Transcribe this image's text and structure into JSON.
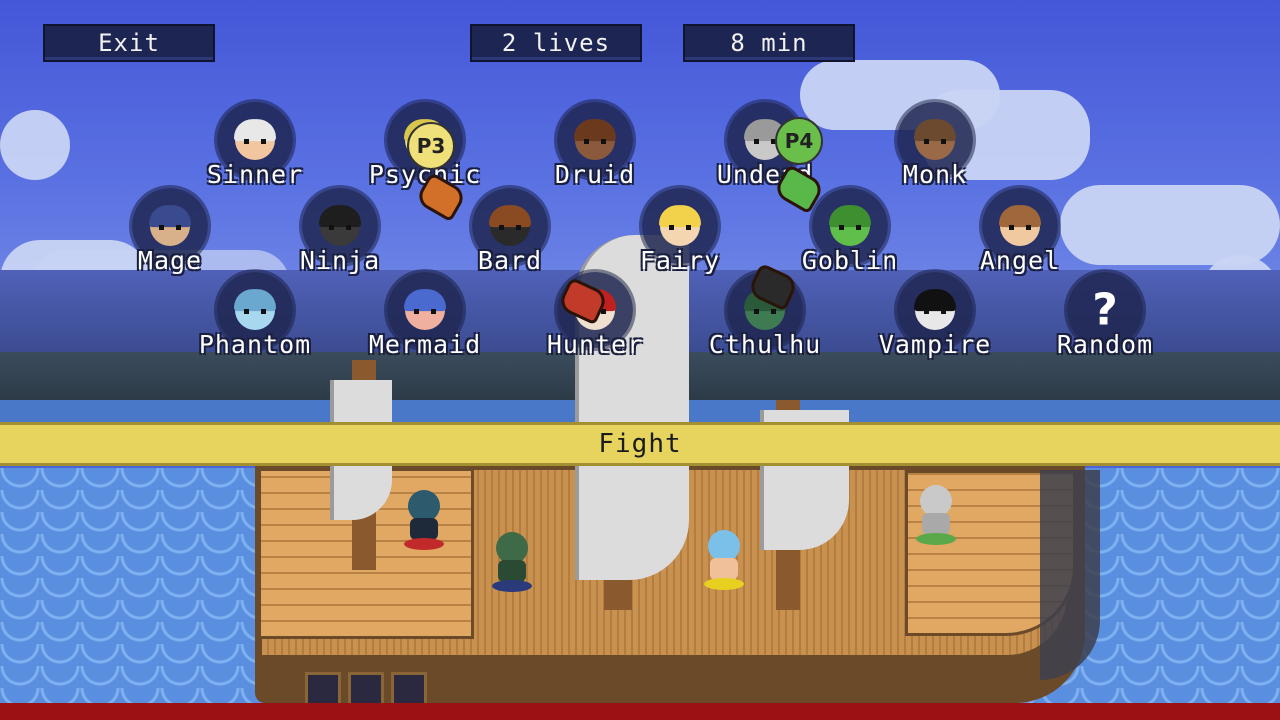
{
  "top_bar": {
    "exit_label": "Exit",
    "lives_label": "2 lives",
    "time_label": "8 min"
  },
  "characters": [
    {
      "name": "Sinner",
      "face": "#f2c7a0",
      "hair": "#e8e8e8"
    },
    {
      "name": "Psychic",
      "face": "#f0e07a",
      "hair": "#d9c64c"
    },
    {
      "name": "Druid",
      "face": "#8b5a3c",
      "hair": "#6b3a1c"
    },
    {
      "name": "Undead",
      "face": "#c9c9c9",
      "hair": "#9a9a9a"
    },
    {
      "name": "Monk",
      "face": "#9a6a48",
      "hair": "#6b4a30"
    },
    {
      "name": "Mage",
      "face": "#d8b08a",
      "hair": "#3a4a8e"
    },
    {
      "name": "Ninja",
      "face": "#3a3a3a",
      "hair": "#1e1e1e"
    },
    {
      "name": "Bard",
      "face": "#2a2a2a",
      "hair": "#8a4a22"
    },
    {
      "name": "Fairy",
      "face": "#f4d7b0",
      "hair": "#f2d24a"
    },
    {
      "name": "Goblin",
      "face": "#5fbf4a",
      "hair": "#3e8f30"
    },
    {
      "name": "Angel",
      "face": "#f0c9a0",
      "hair": "#a0683a"
    },
    {
      "name": "Phantom",
      "face": "#a8d8f0",
      "hair": "#6aa8d0"
    },
    {
      "name": "Mermaid",
      "face": "#f0b0a0",
      "hair": "#4a6ad0"
    },
    {
      "name": "Hunter",
      "face": "#f0e0d0",
      "hair": "#c02020"
    },
    {
      "name": "Cthulhu",
      "face": "#3e7a52",
      "hair": "#2a5a3a"
    },
    {
      "name": "Vampire",
      "face": "#e8e8e8",
      "hair": "#111111"
    },
    {
      "name": "Random",
      "face": "",
      "hair": ""
    }
  ],
  "random_symbol": "?",
  "player_badges": [
    {
      "label": "P3",
      "color": "#f0e07a"
    },
    {
      "label": "P4",
      "color": "#6abf4a"
    }
  ],
  "fight_label": "Fight"
}
